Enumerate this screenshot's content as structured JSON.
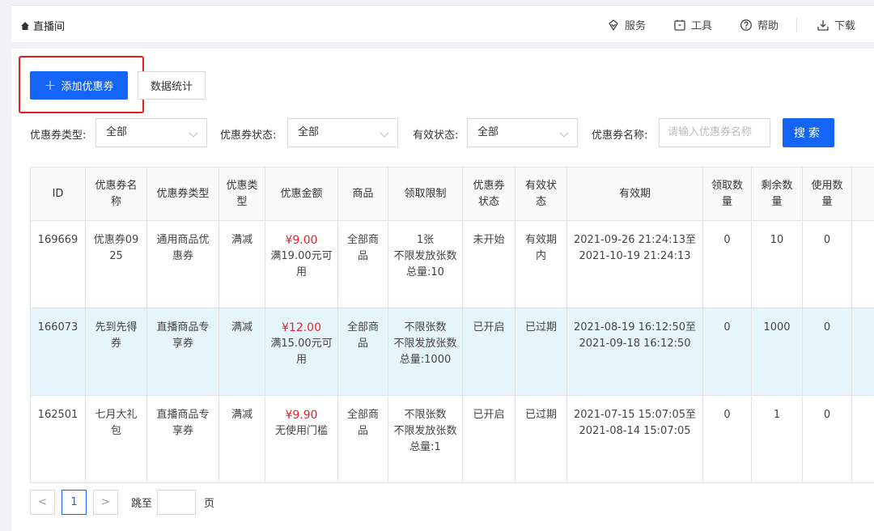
{
  "breadcrumb": {
    "icon": "home-icon",
    "label": "直播间"
  },
  "topnav": [
    {
      "icon": "service-icon",
      "label": "服务"
    },
    {
      "icon": "tools-icon",
      "label": "工具"
    },
    {
      "icon": "help-icon",
      "label": "帮助"
    },
    {
      "icon": "download-icon",
      "label": "下载"
    }
  ],
  "actions": {
    "add_coupon": "添加优惠券",
    "add_plus": "+",
    "stats": "数据统计"
  },
  "filters": {
    "type_label": "优惠券类型:",
    "type_value": "全部",
    "status_label": "优惠券状态:",
    "status_value": "全部",
    "valid_label": "有效状态:",
    "valid_value": "全部",
    "name_label": "优惠券名称:",
    "name_placeholder": "请输入优惠券名称",
    "search": "搜索"
  },
  "table": {
    "headers": [
      "ID",
      "优惠券名称",
      "优惠券类型",
      "优惠类型",
      "优惠金额",
      "商品",
      "领取限制",
      "优惠券状态",
      "有效状态",
      "有效期",
      "领取数量",
      "剩余数量",
      "使用数量",
      ""
    ],
    "rows": [
      {
        "id": "169669",
        "name": "优惠券0925",
        "type": "通用商品优惠券",
        "discount_type": "满减",
        "amount": "¥9.00",
        "amount_cond": "满19.00元可用",
        "goods": "全部商品",
        "limit": [
          "1张",
          "不限发放张数",
          "总量:10"
        ],
        "status": "未开始",
        "valid": "有效期内",
        "period": "2021-09-26 21:24:13至2021-10-19 21:24:13",
        "received": "0",
        "remaining": "10",
        "used": "0",
        "extra": ""
      },
      {
        "id": "166073",
        "name": "先到先得券",
        "type": "直播商品专享券",
        "discount_type": "满减",
        "amount": "¥12.00",
        "amount_cond": "满15.00元可用",
        "goods": "全部商品",
        "limit": [
          "不限张数",
          "不限发放张数",
          "总量:1000"
        ],
        "status": "已开启",
        "valid": "已过期",
        "period": "2021-08-19 16:12:50至2021-09-18 16:12:50",
        "received": "0",
        "remaining": "1000",
        "used": "0",
        "extra": ""
      },
      {
        "id": "162501",
        "name": "七月大礼包",
        "type": "直播商品专享券",
        "discount_type": "满减",
        "amount": "¥9.90",
        "amount_cond": "无使用门槛",
        "goods": "全部商品",
        "limit": [
          "不限张数",
          "不限发放张数",
          "总量:1"
        ],
        "status": "已开启",
        "valid": "已过期",
        "period": "2021-07-15 15:07:05至2021-08-14 15:07:05",
        "received": "0",
        "remaining": "1",
        "used": "0",
        "extra": ""
      }
    ]
  },
  "pagination": {
    "prev": "<",
    "current": "1",
    "next": ">",
    "jump_label": "跳至",
    "unit": "页"
  },
  "colors": {
    "primary": "#1465f5",
    "price": "#e4252c",
    "highlight_row": "#e6f4fb",
    "highlight_box": "#e02020"
  }
}
